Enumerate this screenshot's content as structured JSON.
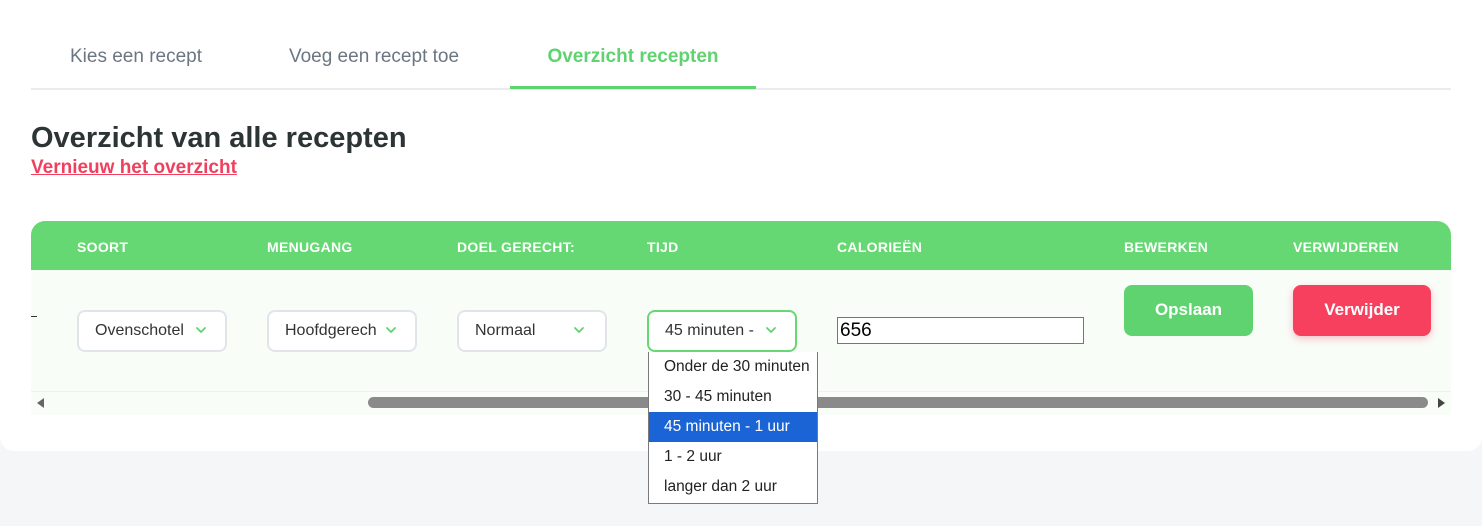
{
  "tabs": [
    {
      "label": "Kies een recept",
      "active": false
    },
    {
      "label": "Voeg een recept toe",
      "active": false
    },
    {
      "label": "Overzicht recepten",
      "active": true
    }
  ],
  "page": {
    "title": "Overzicht van alle recepten",
    "refresh_link": "Vernieuw het overzicht"
  },
  "table": {
    "headers": [
      "SOORT",
      "MENUGANG",
      "DOEL GERECHT:",
      "TIJD",
      "CALORIEËN",
      "BEWERKEN",
      "VERWIJDEREN"
    ],
    "row": {
      "soort": "Ovenschotel",
      "menugang": "Hoofdgerech",
      "doel": "Normaal",
      "tijd": "45 minuten -",
      "calorieen": "656",
      "save_label": "Opslaan",
      "delete_label": "Verwijder"
    }
  },
  "tijd_dropdown": {
    "options": [
      "Onder de 30 minuten",
      "30 - 45 minuten",
      "45 minuten - 1 uur",
      "1 - 2 uur",
      "langer dan 2 uur"
    ],
    "selected": "45 minuten - 1 uur"
  },
  "colors": {
    "accent": "#66d873",
    "danger": "#f7405e",
    "link": "#f0405e",
    "selected_option": "#1a64d6"
  },
  "icons": {
    "select": "chevron-down-icon",
    "scroll_left": "arrow-left-icon",
    "scroll_right": "arrow-right-icon"
  }
}
